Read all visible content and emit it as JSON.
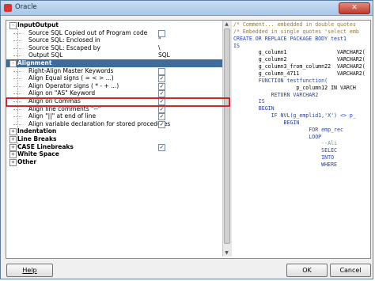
{
  "window": {
    "title": "Oracle",
    "close_icon": "close-x"
  },
  "tree": {
    "rows": [
      {
        "type": "category",
        "toggle": "-",
        "label": "InputOutput",
        "selected": false
      },
      {
        "type": "item",
        "label": "Source SQL Copied out of Program code",
        "control": "checkbox",
        "checked": false
      },
      {
        "type": "item",
        "label": "Source SQL: Enclosed in",
        "control": "text",
        "value": "\""
      },
      {
        "type": "item",
        "label": "Source SQL: Escaped by",
        "control": "text",
        "value": "\\"
      },
      {
        "type": "item",
        "label": "Output SQL",
        "control": "text",
        "value": "SQL"
      },
      {
        "type": "category",
        "toggle": "-",
        "label": "Alignment",
        "selected": true
      },
      {
        "type": "item",
        "label": "Right-Align Master Keywords",
        "control": "checkbox",
        "checked": false
      },
      {
        "type": "item",
        "label": "Align Equal signs ( = < > ...)",
        "control": "checkbox",
        "checked": true
      },
      {
        "type": "item",
        "label": "Align Operator signs ( * - + ...)",
        "control": "checkbox",
        "checked": true
      },
      {
        "type": "item",
        "label": "Align on \"AS\" Keyword",
        "control": "checkbox",
        "checked": true
      },
      {
        "type": "item",
        "label": "Align on Commas",
        "control": "checkbox",
        "checked": true
      },
      {
        "type": "item",
        "label": "Align line comments \"--\"",
        "control": "checkbox",
        "checked": true
      },
      {
        "type": "item",
        "label": "Align \"||\" at end of line",
        "control": "checkbox",
        "checked": true
      },
      {
        "type": "item",
        "label": "Align variable declaration for stored procedures",
        "control": "checkbox",
        "checked": true
      },
      {
        "type": "category",
        "toggle": "+",
        "label": "Indentation",
        "selected": false
      },
      {
        "type": "category",
        "toggle": "+",
        "label": "Line Breaks",
        "selected": false
      },
      {
        "type": "category",
        "toggle": "+",
        "label": "CASE Linebreaks",
        "selected": false,
        "control": "checkbox",
        "checked": true
      },
      {
        "type": "category",
        "toggle": "+",
        "label": "White Space",
        "selected": false
      },
      {
        "type": "category",
        "toggle": "+",
        "label": "Other",
        "selected": false
      }
    ]
  },
  "code": {
    "lines": [
      {
        "text": "/* Comment... embedded in double quotes",
        "color": "#9a7a2a"
      },
      {
        "text": "/* Embedded in single quotes 'select emb",
        "color": "#9a7a2a"
      },
      {
        "text": "CREATE OR REPLACE PACKAGE BODY test1",
        "color": "#1f3fbf"
      },
      {
        "text": "IS",
        "color": "#1f3fbf"
      },
      {
        "text": "        g_column1                VARCHAR2(",
        "color": "#000000"
      },
      {
        "text": "        g_column2                VARCHAR2(",
        "color": "#000000"
      },
      {
        "text": "        g_column3_from_column22  VARCHAR2(",
        "color": "#000000"
      },
      {
        "text": "        g_column_4711            VARCHAR2(",
        "color": "#000000"
      },
      {
        "text": "        FUNCTION testfunction(",
        "color": "#1f3fbf"
      },
      {
        "text": "                    p_column12 IN VARCH",
        "color": "#000000"
      },
      {
        "text": "            RETURN VARCHAR2",
        "color": "#1f3fbf"
      },
      {
        "text": "        IS",
        "color": "#1f3fbf"
      },
      {
        "text": "        BEGIN",
        "color": "#1f3fbf"
      },
      {
        "text": "            IF NVL(g_emplid1,'X') <> p_",
        "color": "#1f3fbf"
      },
      {
        "text": "                BEGIN",
        "color": "#1f3fbf"
      },
      {
        "text": "                        FOR emp_rec",
        "color": "#1f3fbf"
      },
      {
        "text": "                        LOOP",
        "color": "#1f3fbf"
      },
      {
        "text": "                            --Ali",
        "color": "#6a8aa0"
      },
      {
        "text": "                            SELEC",
        "color": "#1f3fbf"
      },
      {
        "text": "                            INTO",
        "color": "#1f3fbf"
      },
      {
        "text": "                            WHERE",
        "color": "#1f3fbf"
      }
    ]
  },
  "buttons": {
    "help": {
      "label": "Help",
      "underline": "H"
    },
    "ok": {
      "label": "OK"
    },
    "cancel": {
      "label": "Cancel"
    }
  }
}
